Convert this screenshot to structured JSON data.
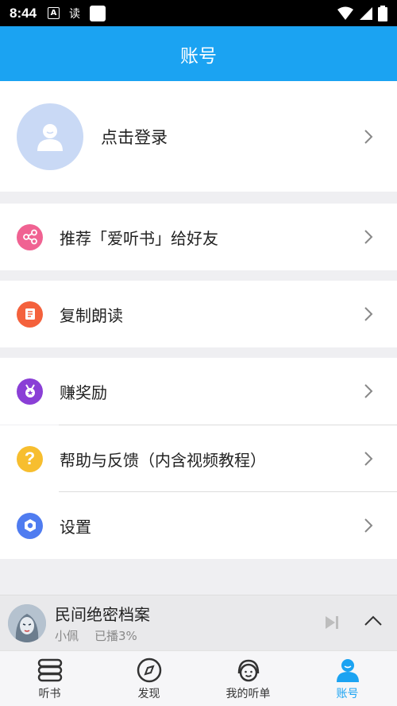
{
  "status_bar": {
    "time": "8:44",
    "a_badge": "A",
    "read_label": "读"
  },
  "header": {
    "title": "账号"
  },
  "login": {
    "label": "点击登录"
  },
  "menu": {
    "recommend": {
      "label": "推荐「爱听书」给好友",
      "color": "#f06292"
    },
    "copy_read": {
      "label": "复制朗读",
      "color": "#f4613c"
    },
    "earn": {
      "label": "赚奖励",
      "color": "#8a3fd6"
    },
    "help": {
      "label": "帮助与反馈（内含视频教程）",
      "color": "#f7be2f"
    },
    "settings": {
      "label": "设置",
      "color": "#4f7cf0"
    }
  },
  "player": {
    "title": "民间绝密档案",
    "narrator": "小佩",
    "progress": "已播3%"
  },
  "tabs": [
    {
      "label": "听书",
      "icon": "book-stack-icon",
      "active": false
    },
    {
      "label": "发现",
      "icon": "compass-icon",
      "active": false
    },
    {
      "label": "我的听单",
      "icon": "headphones-icon",
      "active": false
    },
    {
      "label": "账号",
      "icon": "user-icon",
      "active": true
    }
  ],
  "colors": {
    "accent": "#1ba3f2",
    "avatar_bg": "#c9d9f5"
  }
}
